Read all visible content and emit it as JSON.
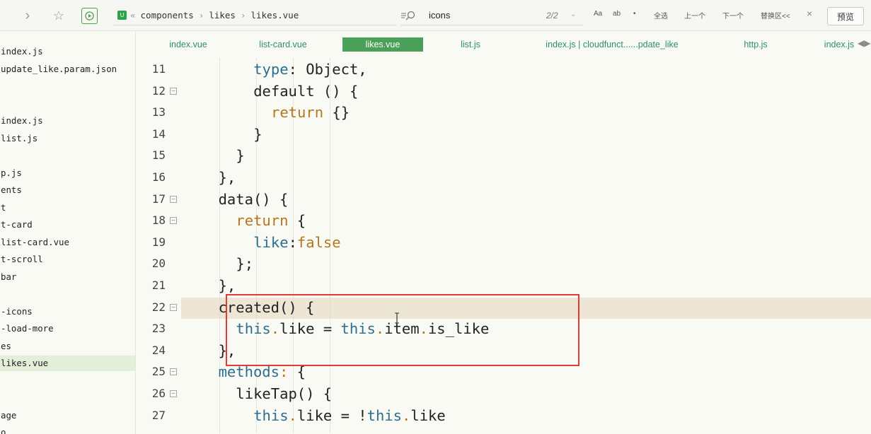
{
  "toolbar": {
    "breadcrumb": [
      "components",
      "likes",
      "likes.vue"
    ],
    "search_value": "icons",
    "search_count": "2/2",
    "find_controls": [
      "Aa",
      "ab",
      "•",
      "全选",
      "上一个",
      "下一个",
      "替换区<<"
    ],
    "preview_label": "预览"
  },
  "sidebar": {
    "items": [
      {
        "label": "index.js",
        "active": false
      },
      {
        "label": "update_like.param.json",
        "active": false
      },
      {
        "label": "",
        "active": false
      },
      {
        "label": "",
        "active": false
      },
      {
        "label": "index.js",
        "active": false
      },
      {
        "label": "list.js",
        "active": false
      },
      {
        "label": "",
        "active": false
      },
      {
        "label": "p.js",
        "active": false
      },
      {
        "label": "ents",
        "active": false
      },
      {
        "label": "t",
        "active": false
      },
      {
        "label": "t-card",
        "active": false
      },
      {
        "label": "list-card.vue",
        "active": false
      },
      {
        "label": "t-scroll",
        "active": false
      },
      {
        "label": "bar",
        "active": false
      },
      {
        "label": "",
        "active": false
      },
      {
        "label": "-icons",
        "active": false
      },
      {
        "label": "-load-more",
        "active": false
      },
      {
        "label": "es",
        "active": false
      },
      {
        "label": "likes.vue",
        "active": true
      },
      {
        "label": "",
        "active": false
      },
      {
        "label": "",
        "active": false
      },
      {
        "label": "age",
        "active": false
      },
      {
        "label": "o",
        "active": false
      }
    ]
  },
  "tabs": [
    {
      "label": "index.vue",
      "active": false
    },
    {
      "label": "list-card.vue",
      "active": false
    },
    {
      "label": "likes.vue",
      "active": true
    },
    {
      "label": "list.js",
      "active": false
    },
    {
      "label": "index.js | cloudfunct......pdate_like",
      "active": false
    },
    {
      "label": "http.js",
      "active": false
    },
    {
      "label": "index.js",
      "active": false
    }
  ],
  "code": {
    "line_numbers": [
      "11",
      "12",
      "13",
      "14",
      "15",
      "16",
      "17",
      "18",
      "19",
      "20",
      "21",
      "22",
      "23",
      "24",
      "25",
      "26",
      "27"
    ],
    "foldable": [
      false,
      true,
      false,
      false,
      false,
      false,
      true,
      true,
      false,
      false,
      false,
      true,
      false,
      false,
      true,
      true,
      false
    ],
    "highlighted_line": "22",
    "lines": [
      [
        [
          "prop",
          "type"
        ],
        [
          "punc",
          ": Object,"
        ]
      ],
      [
        [
          "punc",
          "default () {"
        ]
      ],
      [
        [
          "kw",
          "return"
        ],
        [
          "punc",
          " {}"
        ]
      ],
      [
        [
          "punc",
          "}"
        ]
      ],
      [
        [
          "punc",
          "}"
        ]
      ],
      [
        [
          "punc",
          "},"
        ]
      ],
      [
        [
          "punc",
          "data() {"
        ]
      ],
      [
        [
          "kw",
          "return"
        ],
        [
          "punc",
          " {"
        ]
      ],
      [
        [
          "key",
          "like"
        ],
        [
          "punc",
          ":"
        ],
        [
          "bool",
          "false"
        ]
      ],
      [
        [
          "punc",
          "};"
        ]
      ],
      [
        [
          "punc",
          "},"
        ]
      ],
      [
        [
          "punc",
          "created() {"
        ]
      ],
      [
        [
          "key",
          "this"
        ],
        [
          "dot",
          "."
        ],
        [
          "punc",
          "like = "
        ],
        [
          "key",
          "this"
        ],
        [
          "dot",
          "."
        ],
        [
          "punc",
          "item"
        ],
        [
          "dot",
          "."
        ],
        [
          "punc",
          "is_like"
        ]
      ],
      [
        [
          "punc",
          "},"
        ]
      ],
      [
        [
          "key",
          "methods"
        ],
        [
          "dot",
          ":"
        ],
        [
          "punc",
          " {"
        ]
      ],
      [
        [
          "punc",
          "likeTap() {"
        ]
      ],
      [
        [
          "key",
          "this"
        ],
        [
          "dot",
          "."
        ],
        [
          "punc",
          "like = !"
        ],
        [
          "key",
          "this"
        ],
        [
          "dot",
          "."
        ],
        [
          "punc",
          "like"
        ]
      ]
    ],
    "indents": [
      4,
      4,
      5,
      4,
      3,
      2,
      2,
      3,
      4,
      3,
      2,
      2,
      3,
      2,
      2,
      3,
      4
    ]
  }
}
